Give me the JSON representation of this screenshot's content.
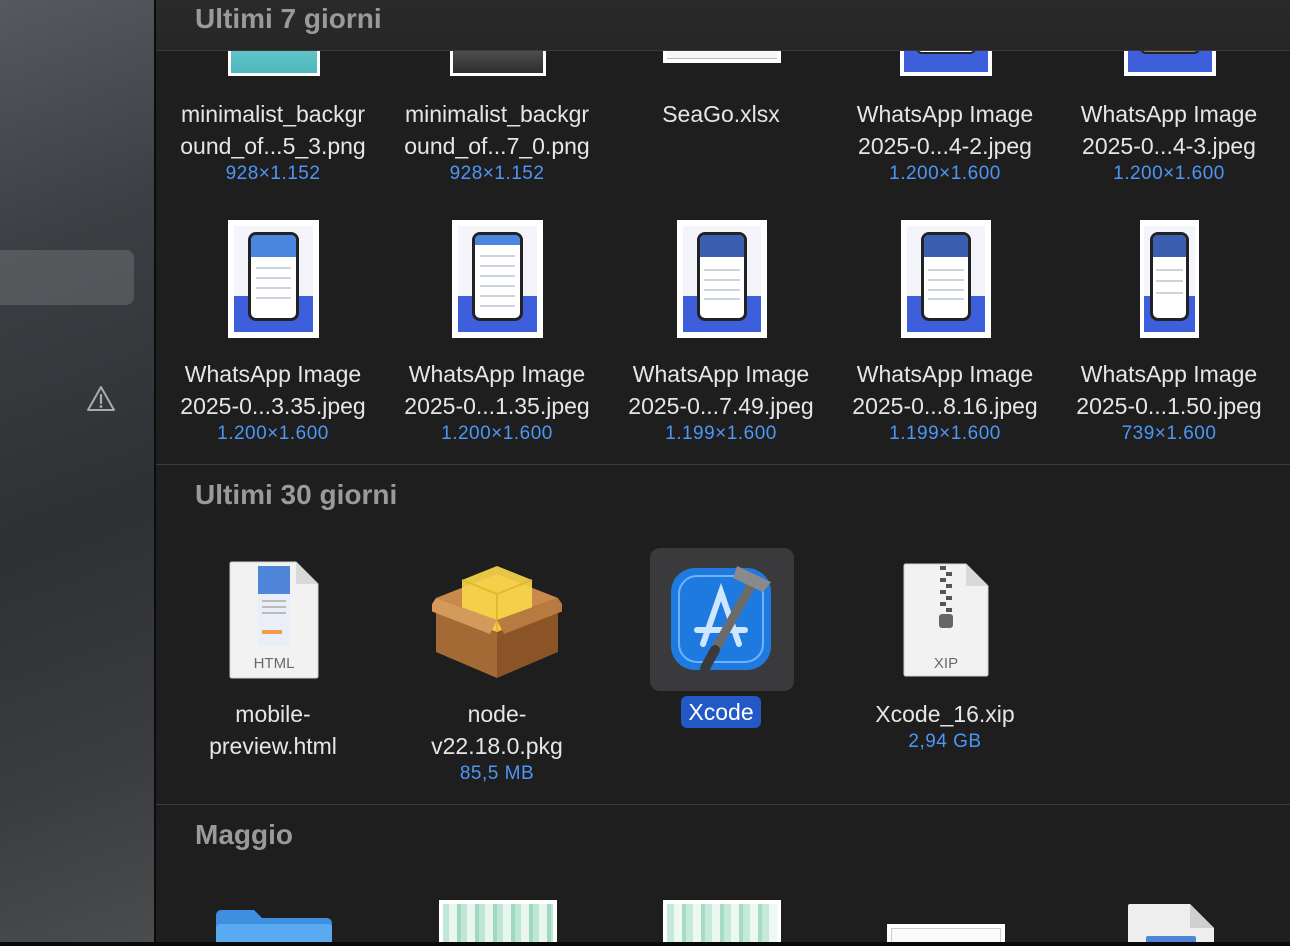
{
  "sidebar": {
    "warning_icon": "warning-triangle-icon"
  },
  "sections": {
    "recent7": {
      "title": "Ultimi 7 giorni"
    },
    "recent30": {
      "title": "Ultimi 30 giorni"
    },
    "may": {
      "title": "Maggio"
    }
  },
  "files_row1": [
    {
      "line1": "minimalist_backgr",
      "line2": "ound_of...5_3.png",
      "dim": "928×1.152"
    },
    {
      "line1": "minimalist_backgr",
      "line2": "ound_of...7_0.png",
      "dim": "928×1.152"
    },
    {
      "line1": "SeaGo.xlsx",
      "line2": "",
      "dim": ""
    },
    {
      "line1": "WhatsApp Image",
      "line2": "2025-0...4-2.jpeg",
      "dim": "1.200×1.600"
    },
    {
      "line1": "WhatsApp Image",
      "line2": "2025-0...4-3.jpeg",
      "dim": "1.200×1.600"
    }
  ],
  "files_row2": [
    {
      "line1": "WhatsApp Image",
      "line2": "2025-0...3.35.jpeg",
      "dim": "1.200×1.600"
    },
    {
      "line1": "WhatsApp Image",
      "line2": "2025-0...1.35.jpeg",
      "dim": "1.200×1.600"
    },
    {
      "line1": "WhatsApp Image",
      "line2": "2025-0...7.49.jpeg",
      "dim": "1.199×1.600"
    },
    {
      "line1": "WhatsApp Image",
      "line2": "2025-0...8.16.jpeg",
      "dim": "1.199×1.600"
    },
    {
      "line1": "WhatsApp Image",
      "line2": "2025-0...1.50.jpeg",
      "dim": "739×1.600"
    }
  ],
  "files_row3": [
    {
      "line1": "mobile-",
      "line2": "preview.html",
      "dim": "",
      "badge": "HTML"
    },
    {
      "line1": "node-",
      "line2": "v22.18.0.pkg",
      "dim": "85,5 MB"
    },
    {
      "line1": "Xcode",
      "line2": "",
      "dim": ""
    },
    {
      "line1": "Xcode_16.xip",
      "line2": "",
      "dim": "2,94 GB",
      "badge": "XIP"
    }
  ],
  "colors": {
    "accent": "#2358c7",
    "dim_text": "#4d96f5",
    "section_title": "#9a9a9a"
  }
}
